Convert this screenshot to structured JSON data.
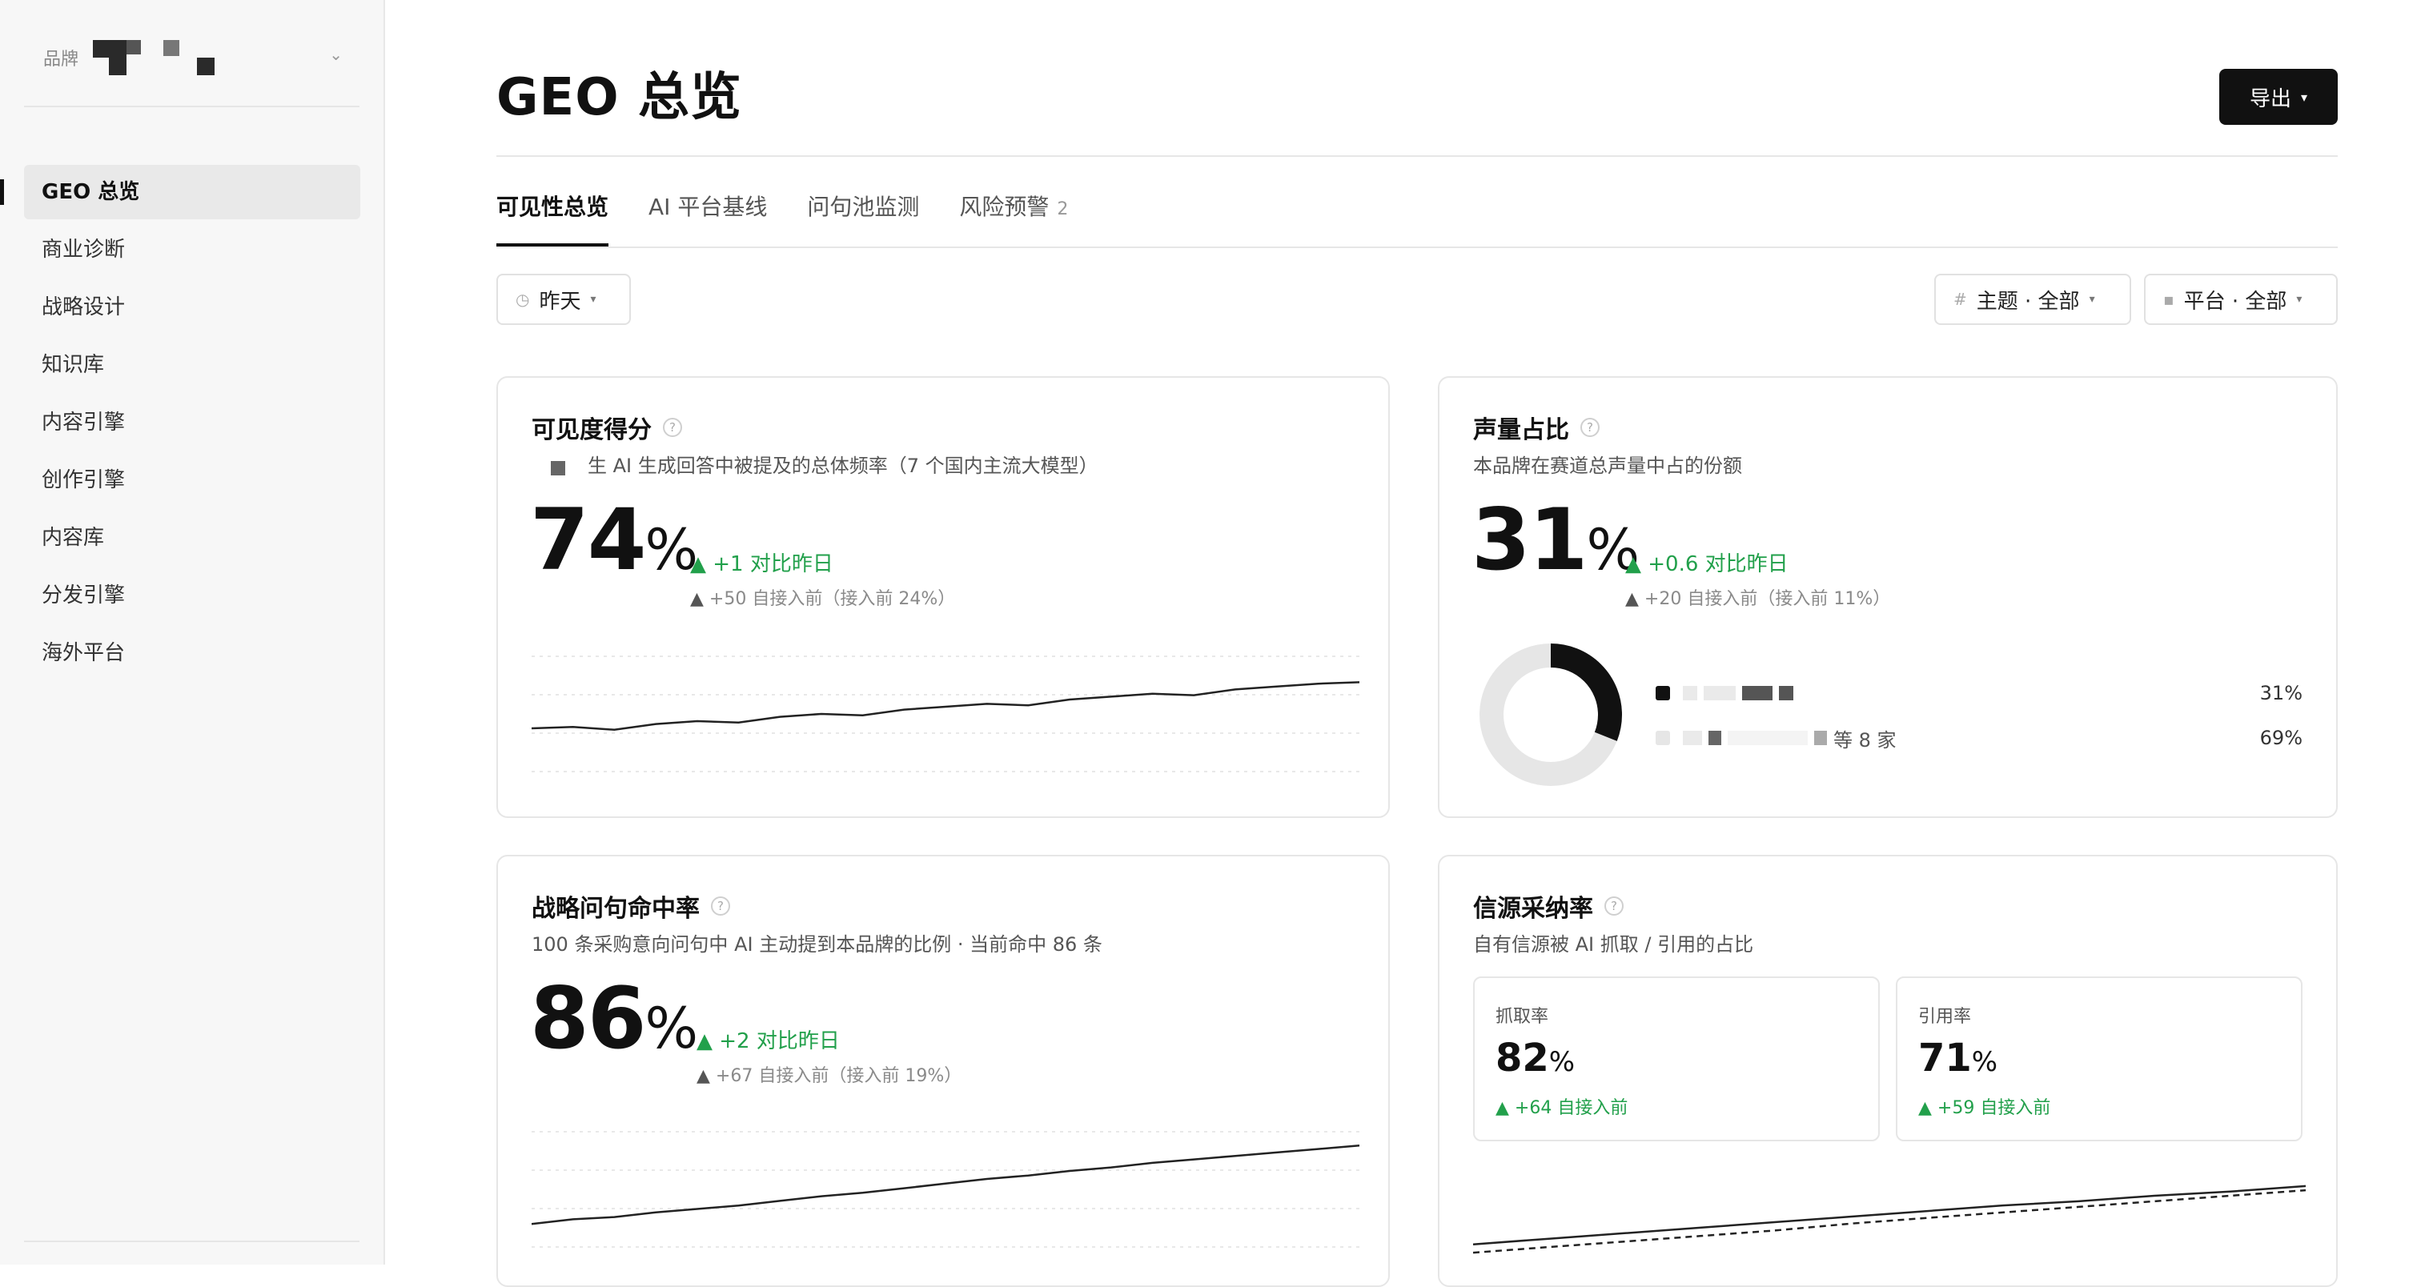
{
  "sidebar": {
    "brand_label": "品牌",
    "items": [
      {
        "label": "GEO 总览",
        "active": true
      },
      {
        "label": "商业诊断"
      },
      {
        "label": "战略设计"
      },
      {
        "label": "知识库"
      },
      {
        "label": "内容引擎"
      },
      {
        "label": "创作引擎"
      },
      {
        "label": "内容库"
      },
      {
        "label": "分发引擎"
      },
      {
        "label": "海外平台"
      }
    ]
  },
  "header": {
    "title": "GEO 总览",
    "export_label": "导出"
  },
  "tabs": [
    {
      "label": "可见性总览",
      "active": true
    },
    {
      "label": "AI 平台基线"
    },
    {
      "label": "问句池监测"
    },
    {
      "label": "风险预警",
      "count": "2"
    }
  ],
  "filters": {
    "date": "昨天",
    "topic": "主题 · 全部",
    "platform": "平台 · 全部"
  },
  "cards": {
    "visibility": {
      "title": "可见度得分",
      "subtitle": "生 AI 生成回答中被提及的总体频率（7 个国内主流大模型）",
      "value": "74",
      "unit": "%",
      "delta": "▲ +1 对比昨日",
      "since": "+50 自接入前（接入前 24%）",
      "trend": [
        30,
        31,
        29,
        33,
        35,
        34,
        38,
        40,
        39,
        43,
        45,
        47,
        46,
        50,
        52,
        54,
        53,
        57,
        59,
        61,
        62
      ]
    },
    "share": {
      "title": "声量占比",
      "subtitle": "本品牌在赛道总声量中占的份额",
      "value": "31",
      "unit": "%",
      "delta": "▲ +0.6 对比昨日",
      "since": "+20 自接入前（接入前 11%）",
      "donut": [
        {
          "label": "",
          "value": 31,
          "display": "31%",
          "color": "#111111"
        },
        {
          "label": "等 8 家",
          "value": 69,
          "display": "69%",
          "color": "#e6e6e6"
        }
      ]
    },
    "strategy": {
      "title": "战略问句命中率",
      "subtitle": "100 条采购意向问句中 AI 主动提到本品牌的比例 · 当前命中 86 条",
      "value": "86",
      "unit": "%",
      "delta": "▲ +2 对比昨日",
      "since": "+67 自接入前（接入前 19%）",
      "trend": [
        20,
        24,
        26,
        30,
        33,
        36,
        40,
        44,
        47,
        51,
        55,
        59,
        62,
        66,
        69,
        73,
        76,
        79,
        82,
        85,
        88
      ]
    },
    "source": {
      "title": "信源采纳率",
      "subtitle": "自有信源被 AI 抓取 / 引用的占比",
      "crawl": {
        "label": "抓取率",
        "value": "82",
        "unit": "%",
        "delta": "▲ +64 自接入前"
      },
      "cite": {
        "label": "引用率",
        "value": "71",
        "unit": "%",
        "delta": "▲ +59 自接入前"
      },
      "trend_crawl": [
        10,
        14,
        18,
        22,
        26,
        30,
        34,
        38,
        41,
        45,
        48,
        52
      ],
      "trend_cite": [
        4,
        8,
        12,
        16,
        20,
        25,
        29,
        33,
        37,
        41,
        45,
        49
      ]
    }
  }
}
